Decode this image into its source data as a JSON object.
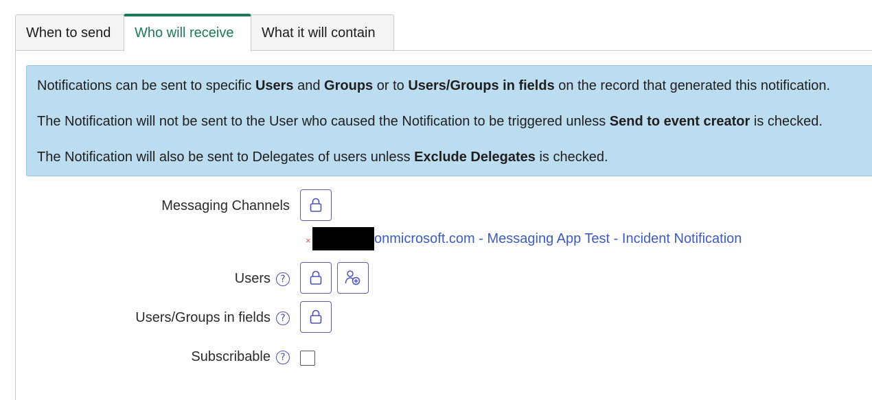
{
  "tabs": [
    {
      "label": "When to send",
      "active": false
    },
    {
      "label": "Who will receive",
      "active": true
    },
    {
      "label": "What it will contain",
      "active": false
    }
  ],
  "info": {
    "line1": {
      "pre": "Notifications can be sent to specific ",
      "b1": "Users",
      "mid1": " and ",
      "b2": "Groups",
      "mid2": " or to ",
      "b3": "Users/Groups in fields",
      "post": " on the record that generated this notification."
    },
    "line2": {
      "pre": "The Notification will not be sent to the User who caused the Notification to be triggered unless ",
      "b1": "Send to event creator",
      "post": " is checked."
    },
    "line3": {
      "pre": "The Notification will also be sent to Delegates of users unless ",
      "b1": "Exclude Delegates",
      "post": " is checked."
    }
  },
  "fields": {
    "messaging_channels": {
      "label": "Messaging Channels",
      "value": "onmicrosoft.com - Messaging App Test - Incident Notification",
      "remove_glyph": "×"
    },
    "users": {
      "label": "Users"
    },
    "users_groups": {
      "label": "Users/Groups in fields"
    },
    "subscribable": {
      "label": "Subscribable",
      "checked": false
    }
  },
  "icons": {
    "lock": "lock-icon",
    "add_user": "add-user-icon",
    "help": "help-circle-icon",
    "help_glyph": "?"
  },
  "colors": {
    "accent": "#1b7a59",
    "info_bg": "#bcdcf0",
    "link": "#3d5bbf",
    "icon": "#4a53b8"
  }
}
